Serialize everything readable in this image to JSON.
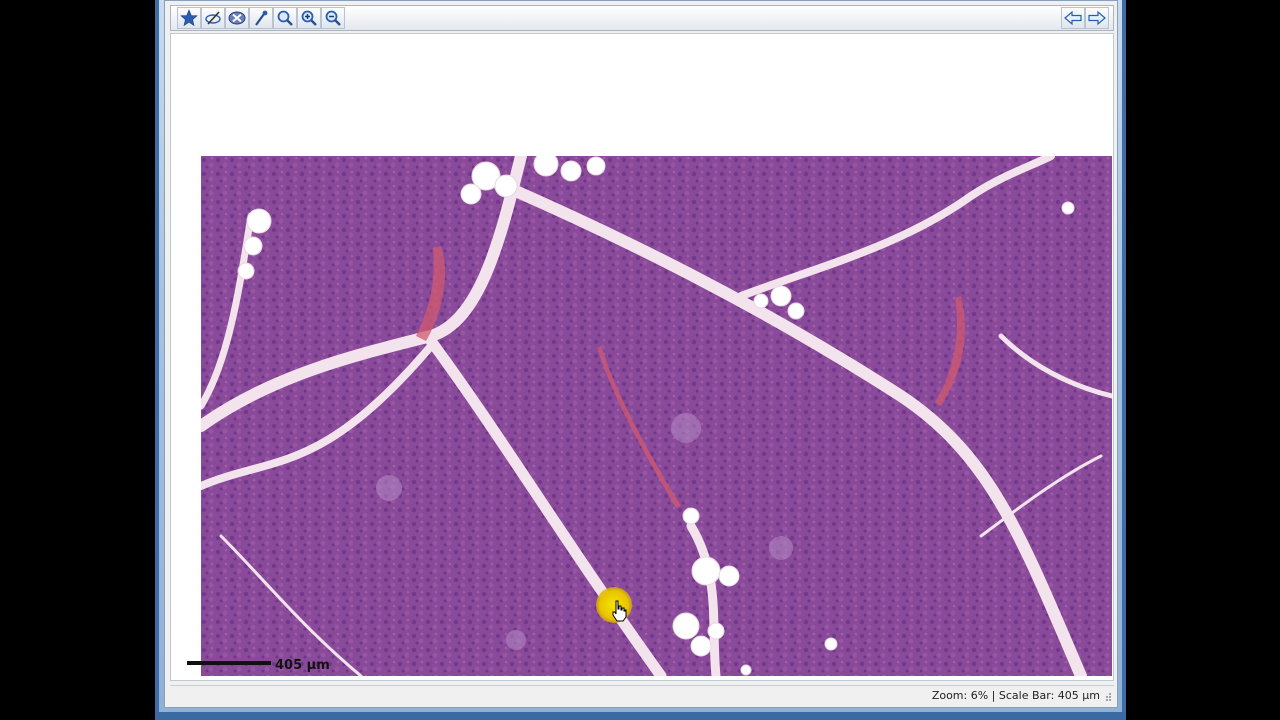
{
  "toolbar": {
    "tools": [
      {
        "icon": "star-icon",
        "label": ""
      },
      {
        "icon": "pen-annotation-icon",
        "label": ""
      },
      {
        "icon": "delete-annotation-icon",
        "label": ""
      },
      {
        "icon": "magic-wand-icon",
        "label": ""
      },
      {
        "icon": "magnifier-icon",
        "label": ""
      },
      {
        "icon": "zoom-in-icon",
        "label": ""
      },
      {
        "icon": "zoom-out-icon",
        "label": ""
      }
    ],
    "nav": [
      {
        "icon": "back-arrow-icon"
      },
      {
        "icon": "forward-arrow-icon"
      }
    ]
  },
  "viewer": {
    "scale_label": "405 µm"
  },
  "status": {
    "text": "Zoom: 6% | Scale Bar: 405 µm"
  },
  "colors": {
    "tissue": "#8a4a9a",
    "stroma": "#f2e4ec",
    "fat": "#ffffff",
    "highlight": "#f6e400"
  }
}
